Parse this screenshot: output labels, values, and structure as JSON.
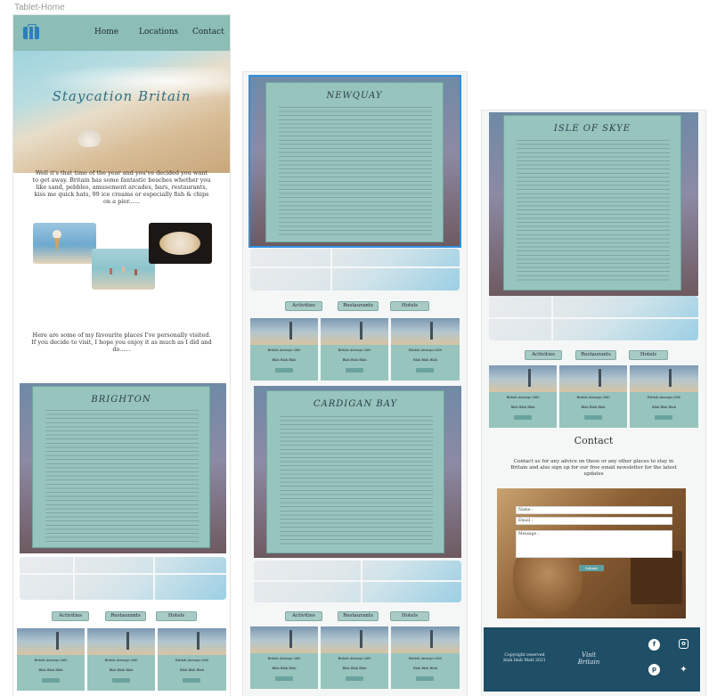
{
  "frame": {
    "label": "Tablet-Home"
  },
  "nav": {
    "logo_icon": "suitcase-icon",
    "links": [
      "Home",
      "Locations",
      "Contact"
    ]
  },
  "hero": {
    "title": "Staycation Britain"
  },
  "intro": {
    "lines": [
      "Well it's that time of the year and you've decided you want",
      "to get away.  Britain has some fantastic beaches whether you",
      "like sand, pebbles, amusement arcades, bars, restaurants,",
      "kiss me quick hats, 99 ice creams or especially fish & chips",
      "on a pier......"
    ]
  },
  "favourites": {
    "lines": [
      "Here are some of my favourite places I've personally visited.",
      "If you decide to visit, I hope you enjoy it as much as I did and",
      "do......"
    ]
  },
  "places": [
    {
      "title": "BRIGHTON"
    },
    {
      "title": "NEWQUAY"
    },
    {
      "title": "CARDIGAN BAY"
    },
    {
      "title": "ISLE OF SKYE"
    }
  ],
  "pills": [
    "Activities",
    "Restaurants",
    "Hotels"
  ],
  "tile": {
    "name": "British Airways i360",
    "desc": "Blah Blah Blah"
  },
  "contact": {
    "title": "Contact",
    "lines": [
      "Contact us for any advice on these or any other places to stay in",
      "Britain and also sign up for our free email newsletter for the latest",
      "updates"
    ],
    "name_label": "Name :",
    "email_label": "Email :",
    "message_label": "Message :",
    "submit_label": "Submit"
  },
  "footer": {
    "copyright_line1": "Copyright reserved",
    "copyright_line2": "blah blah Matt 2021",
    "brand_line1": "Visit",
    "brand_line2": "Britain",
    "socials": [
      "facebook-icon",
      "instagram-icon",
      "pinterest-icon",
      "twitter-icon"
    ]
  },
  "colors": {
    "accent": "#8dbdb7",
    "panel": "#97c4bd",
    "footer": "#1f4e67",
    "selection": "#2f8fe0"
  }
}
